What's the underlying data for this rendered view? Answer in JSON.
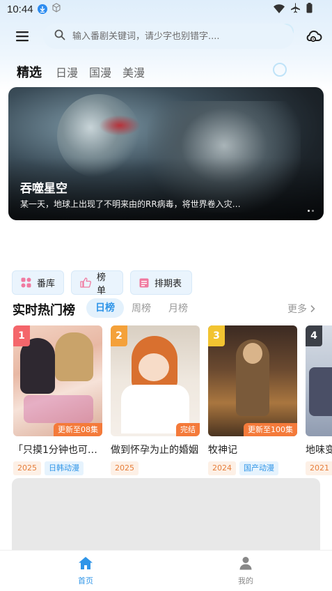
{
  "status_bar": {
    "time": "10:44"
  },
  "header": {
    "search_placeholder": "输入番剧关键词，请少字也别错字...."
  },
  "tabs": [
    {
      "label": "精选",
      "active": true
    },
    {
      "label": "日漫",
      "active": false
    },
    {
      "label": "国漫",
      "active": false
    },
    {
      "label": "美漫",
      "active": false
    }
  ],
  "banner": {
    "title": "吞噬星空",
    "description": "某一天，地球上出现了不明来由的RR病毒，将世界卷入灾…"
  },
  "quick_links": [
    {
      "label": "番库",
      "icon": "grid-icon",
      "color": "#f07aa0"
    },
    {
      "label": "榜单",
      "icon": "thumb-up-icon",
      "color": "#f07aa0"
    },
    {
      "label": "排期表",
      "icon": "calendar-icon",
      "color": "#f07aa0"
    }
  ],
  "ranking": {
    "title": "实时热门榜",
    "tabs": [
      {
        "label": "日榜",
        "active": true
      },
      {
        "label": "周榜",
        "active": false
      },
      {
        "label": "月榜",
        "active": false
      }
    ],
    "more_label": "更多",
    "items": [
      {
        "rank": "1",
        "badge_color": "#f4666b",
        "episode": "更新至08集",
        "name": "「只摸1分钟也可…",
        "year": "2025",
        "category": "日韩动漫"
      },
      {
        "rank": "2",
        "badge_color": "#f4a13a",
        "episode": "完结",
        "name": "做到怀孕为止的婚姻",
        "year": "2025",
        "category": ""
      },
      {
        "rank": "3",
        "badge_color": "#f2c431",
        "episode": "更新至100集",
        "name": "牧神记",
        "year": "2024",
        "category": "国产动漫"
      },
      {
        "rank": "4",
        "badge_color": "#3c4048",
        "episode": "",
        "name": "地味变",
        "year": "2021",
        "category": ""
      }
    ]
  },
  "bottom_nav": [
    {
      "label": "首页",
      "active": true,
      "icon": "home-icon"
    },
    {
      "label": "我的",
      "active": false,
      "icon": "user-icon"
    }
  ],
  "colors": {
    "accent": "#2f95e8",
    "episode_badge": "#f47a3a"
  }
}
